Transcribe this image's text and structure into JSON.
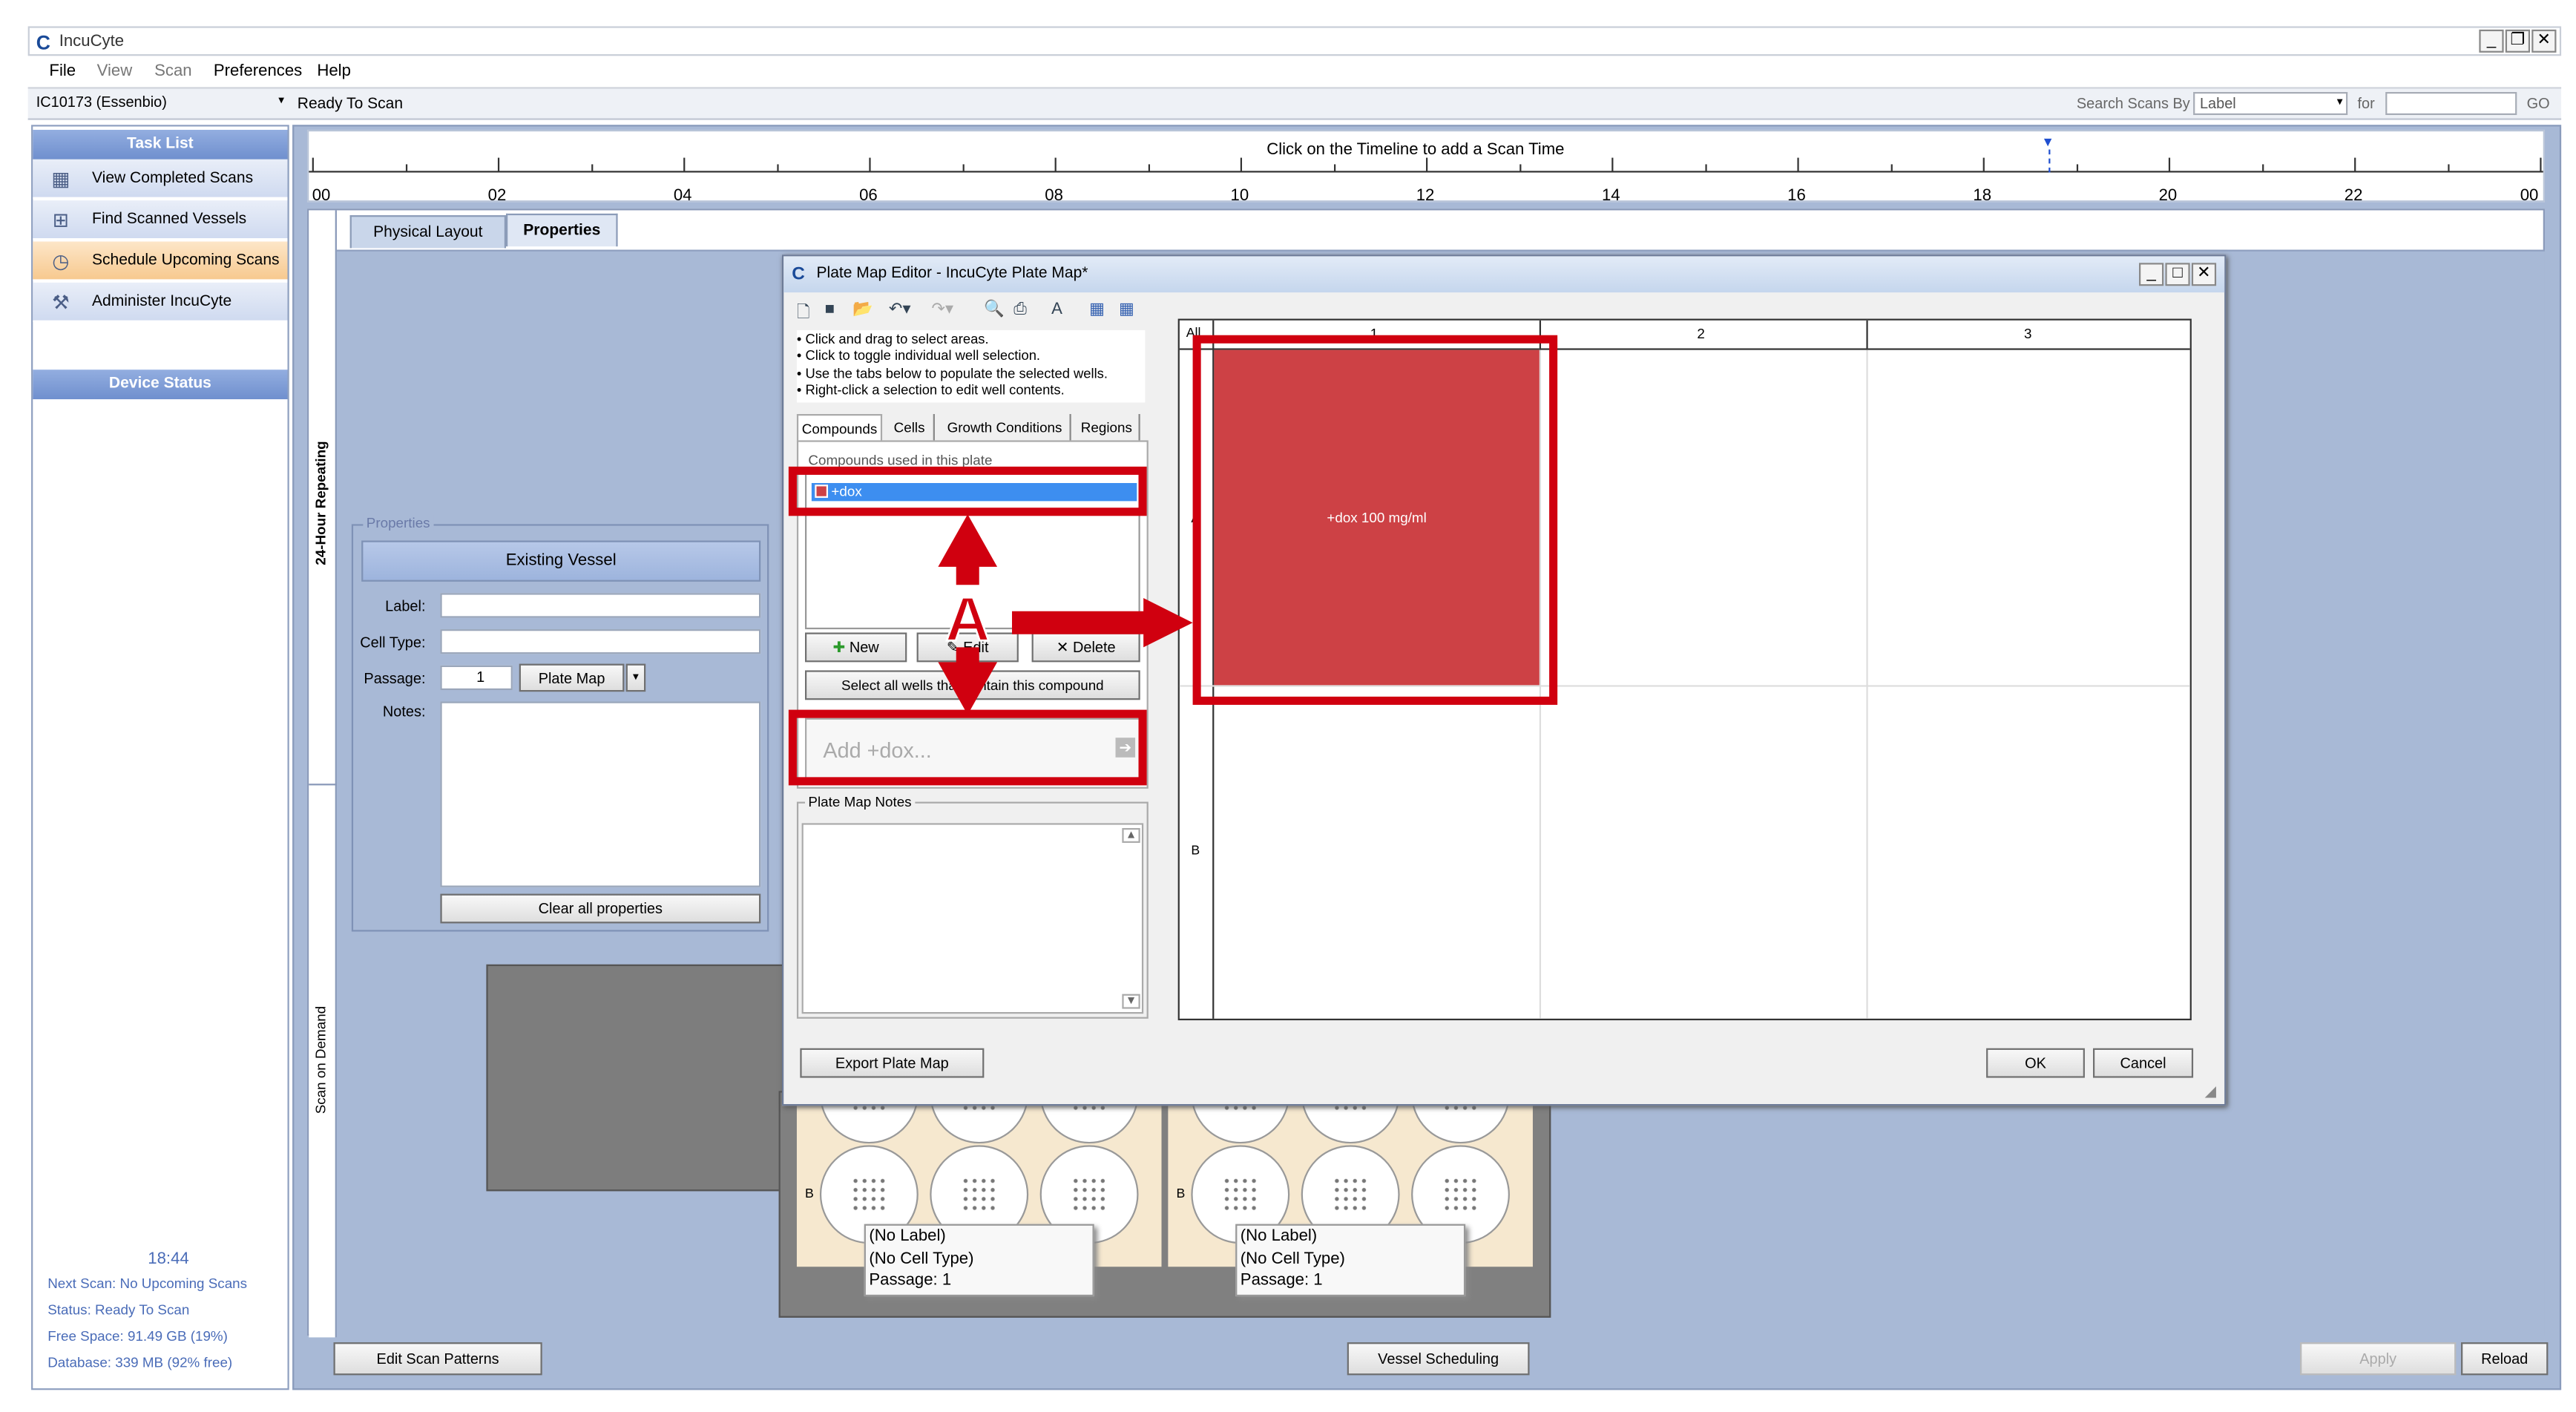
{
  "app": {
    "title": "IncuCyte"
  },
  "menu": {
    "file": "File",
    "view": "View",
    "scan": "Scan",
    "preferences": "Preferences",
    "help": "Help"
  },
  "toolbar": {
    "device": "IC10173 (Essenbio)",
    "status": "Ready To Scan",
    "search_label": "Search Scans By",
    "search_by": "Label",
    "for_label": "for",
    "search_value": "",
    "go": "GO"
  },
  "sidebar": {
    "task_list": "Task List",
    "items": [
      "View Completed Scans",
      "Find Scanned Vessels",
      "Schedule Upcoming Scans",
      "Administer IncuCyte"
    ],
    "device_status": "Device Status",
    "time": "18:44",
    "next_scan": "Next Scan: No Upcoming Scans",
    "status": "Status: Ready To Scan",
    "free_space": "Free Space: 91.49 GB (19%)",
    "database": "Database: 339 MB (92% free)"
  },
  "timeline": {
    "hint": "Click on the Timeline to add a Scan Time",
    "labels": [
      "00",
      "02",
      "04",
      "06",
      "08",
      "10",
      "12",
      "14",
      "16",
      "18",
      "20",
      "22",
      "00"
    ],
    "marker_hour": 18.7
  },
  "vertical": {
    "repeating": "24-Hour Repeating",
    "on_demand": "Scan on Demand"
  },
  "tabs": {
    "physical": "Physical Layout",
    "properties": "Properties"
  },
  "props": {
    "legend": "Properties",
    "existing": "Existing Vessel",
    "label": "Label:",
    "label_value": "",
    "cell_type": "Cell Type:",
    "cell_value": "",
    "passage": "Passage:",
    "passage_value": "1",
    "plate_map": "Plate Map",
    "notes": "Notes:",
    "clear": "Clear all properties"
  },
  "plates": {
    "row_b": "B",
    "tooltips": [
      {
        "label": "(No Label)",
        "cell": "(No Cell Type)",
        "passage": "Passage: 1"
      },
      {
        "label": "(No Label)",
        "cell": "(No Cell Type)",
        "passage": "Passage: 1"
      }
    ]
  },
  "dialog": {
    "title": "Plate Map Editor - IncuCyte Plate Map*",
    "instructions": [
      "• Click and drag to select areas.",
      "• Click to toggle individual well selection.",
      "• Use the tabs below to populate the selected wells.",
      "• Right-click a selection to edit well contents."
    ],
    "tabs": [
      "Compounds",
      "Cells",
      "Growth Conditions",
      "Regions"
    ],
    "list_caption": "Compounds used in this plate",
    "compound": "+dox",
    "new": "New",
    "edit": "Edit",
    "delete": "Delete",
    "select_all": "Select all wells that contain this compound",
    "add_placeholder": "Add +dox...",
    "notes_legend": "Plate Map Notes",
    "export": "Export Plate Map",
    "ok": "OK",
    "cancel": "Cancel",
    "grid_all": "All",
    "columns": [
      "1",
      "2",
      "3"
    ],
    "rows": [
      "A",
      "B"
    ],
    "well_label": "+dox 100 mg/ml",
    "well_color": "#cd4145",
    "annotation": "A"
  },
  "bottom": {
    "edit_patterns": "Edit Scan Patterns",
    "vessel_scheduling": "Vessel Scheduling",
    "apply": "Apply",
    "reload": "Reload"
  },
  "colors": {
    "highlight": "#d0000f",
    "well": "#cd4145",
    "selection": "#3d8ef0"
  }
}
